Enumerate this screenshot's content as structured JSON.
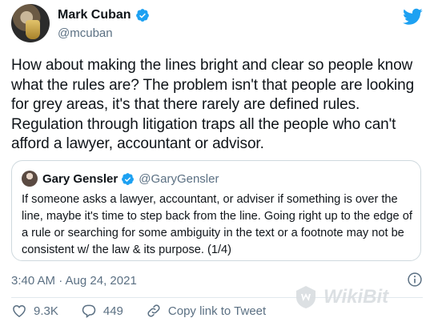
{
  "author": {
    "name": "Mark Cuban",
    "handle": "@mcuban"
  },
  "tweet": {
    "text": "How about making the lines bright and clear so people know what the rules are? The problem isn't that people are looking for grey areas, it's that there rarely are defined rules. Regulation through litigation traps all the people who can't afford a lawyer, accountant or advisor."
  },
  "quoted": {
    "name": "Gary Gensler",
    "handle": "@GaryGensler",
    "text": "If someone asks a lawyer, accountant, or adviser if something is over the line, maybe it's time to step back from the line. Going right up to the edge of a rule or searching for some ambiguity in the text or a footnote may not be consistent w/ the law & its purpose. (1/4)"
  },
  "meta": {
    "timestamp": "3:40 AM · Aug 24, 2021"
  },
  "actions": {
    "likes": "9.3K",
    "replies": "449",
    "copy_link": "Copy link to Tweet"
  },
  "watermark": {
    "text": "WikiBit"
  },
  "colors": {
    "twitter_blue": "#1da1f2",
    "secondary_text": "#5b7083",
    "border": "#cfd9de"
  },
  "icons": [
    "verified-badge-icon",
    "twitter-bird-icon",
    "info-icon",
    "heart-icon",
    "reply-icon",
    "link-icon"
  ]
}
